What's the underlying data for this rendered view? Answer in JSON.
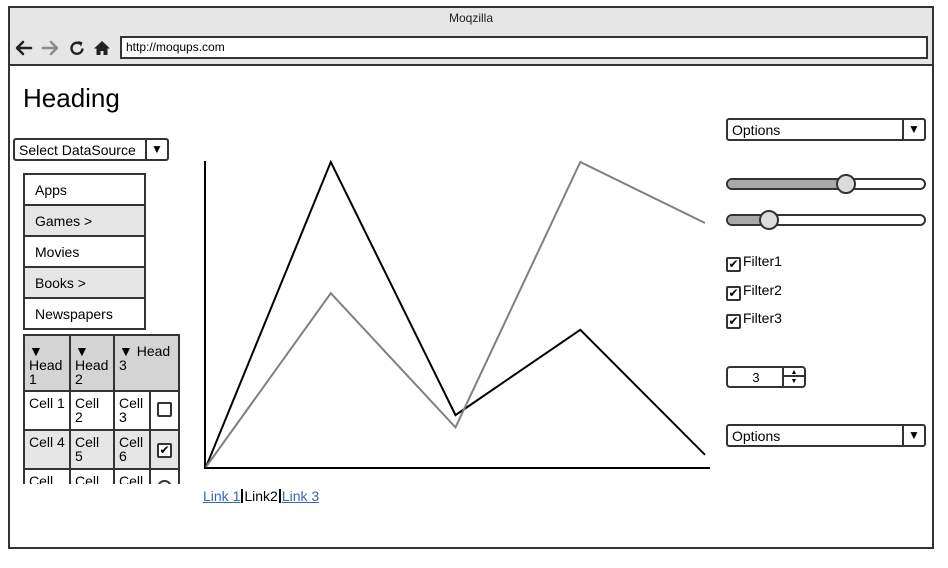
{
  "window": {
    "title": "Moqzilla",
    "url": "http://moqups.com",
    "nav_icons": [
      "back-arrow-icon",
      "forward-arrow-icon",
      "reload-icon",
      "home-icon"
    ]
  },
  "page": {
    "heading": "Heading",
    "datasource_select": {
      "value": "Select DataSource"
    },
    "menu": [
      {
        "label": "Apps",
        "active": false
      },
      {
        "label": "Games >",
        "active": true
      },
      {
        "label": "Movies",
        "active": false
      },
      {
        "label": "Books >",
        "active": true
      },
      {
        "label": "Newspapers",
        "active": false
      }
    ],
    "table": {
      "headers": [
        "Head 1",
        "Head 2",
        "Head 3"
      ],
      "rows": [
        {
          "cells": [
            "Cell 1",
            "Cell 2",
            "Cell 3"
          ],
          "checked": false
        },
        {
          "cells": [
            "Cell 4",
            "Cell 5",
            "Cell 6"
          ],
          "checked": true
        },
        {
          "cells": [
            "Cell",
            "Cell",
            "Cell"
          ],
          "checked": false
        }
      ]
    },
    "links": [
      "Link 1",
      "Link2",
      "Link 3"
    ],
    "options_top": {
      "value": "Options"
    },
    "sliders": [
      {
        "value_fraction": 0.6
      },
      {
        "value_fraction": 0.21
      }
    ],
    "filters": [
      {
        "label": "Filter1",
        "checked": true
      },
      {
        "label": "Filter2",
        "checked": true
      },
      {
        "label": "Filter3",
        "checked": true
      }
    ],
    "stepper": {
      "value": "3"
    },
    "options_bottom": {
      "value": "Options"
    }
  },
  "chart_data": {
    "type": "line",
    "x": [
      0,
      1,
      2,
      3,
      4
    ],
    "series": [
      {
        "color": "#000000",
        "values": [
          0,
          1,
          0.17,
          0.45,
          0.04
        ]
      },
      {
        "color": "#808080",
        "values": [
          0,
          0.57,
          0.13,
          1,
          0.8
        ]
      }
    ],
    "ylim": [
      0,
      1.0
    ],
    "grid": false
  }
}
